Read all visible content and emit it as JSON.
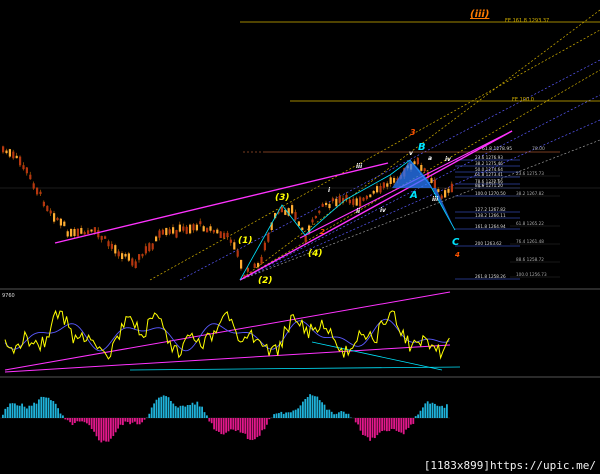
{
  "chart_data": {
    "type": "candlestick",
    "main_panel": {
      "header_wave_label": "(iii)",
      "fe_level_label": "FE 161.8 1293.37",
      "fe_level_label_2": "FE 100.0",
      "fib_grid": [
        {
          "label": "23.6",
          "value": "1276.93"
        },
        {
          "label": "38.2",
          "value": "1275.46"
        },
        {
          "label": "50.0",
          "value": "1274.64"
        },
        {
          "label": "61.8",
          "value": "1273.41"
        },
        {
          "label": "78.6",
          "value": "1272.66"
        },
        {
          "label": "88.6",
          "value": "1271.20"
        },
        {
          "label": "100.0",
          "value": "1270.50"
        },
        {
          "label": "127.2",
          "value": "1267.82"
        },
        {
          "label": "138.2",
          "value": "1266.11"
        },
        {
          "label": "161.8",
          "value": "1264.94"
        },
        {
          "label": "200",
          "value": "1263.62"
        },
        {
          "label": "261.8",
          "value": "1258.26"
        }
      ],
      "fib_top_label": "61.8 1278.95",
      "fib_top_ref": "78.00",
      "fib_right_labels": [
        {
          "label": "23.6",
          "value": "1275.73"
        },
        {
          "label": "38.2",
          "value": "1267.82"
        },
        {
          "label": "61.8",
          "value": "1265.22"
        },
        {
          "label": "76.4",
          "value": "1261.48"
        },
        {
          "label": "88.6",
          "value": "1258.72"
        },
        {
          "label": "100.0",
          "value": "1256.73"
        }
      ],
      "wave_labels": {
        "w1": "(1)",
        "w2": "(2)",
        "w3": "(3)",
        "w4": "(4)",
        "small_i": "i",
        "small_ii": "ii",
        "small_iii": "iii",
        "small_iv": "iv",
        "red_2": "2",
        "red_3": "3",
        "red_4": "4",
        "pattern_A": "A",
        "pattern_B": "B",
        "pattern_C": "C",
        "blue_iii": "iii",
        "blue_iv": "iv",
        "b_small": "a",
        "v_small": "v"
      }
    },
    "oscillator_panel": {
      "label": "9760"
    },
    "histogram_panel": {
      "label": ""
    }
  },
  "watermark": "[1183x899]https://upic.me/"
}
